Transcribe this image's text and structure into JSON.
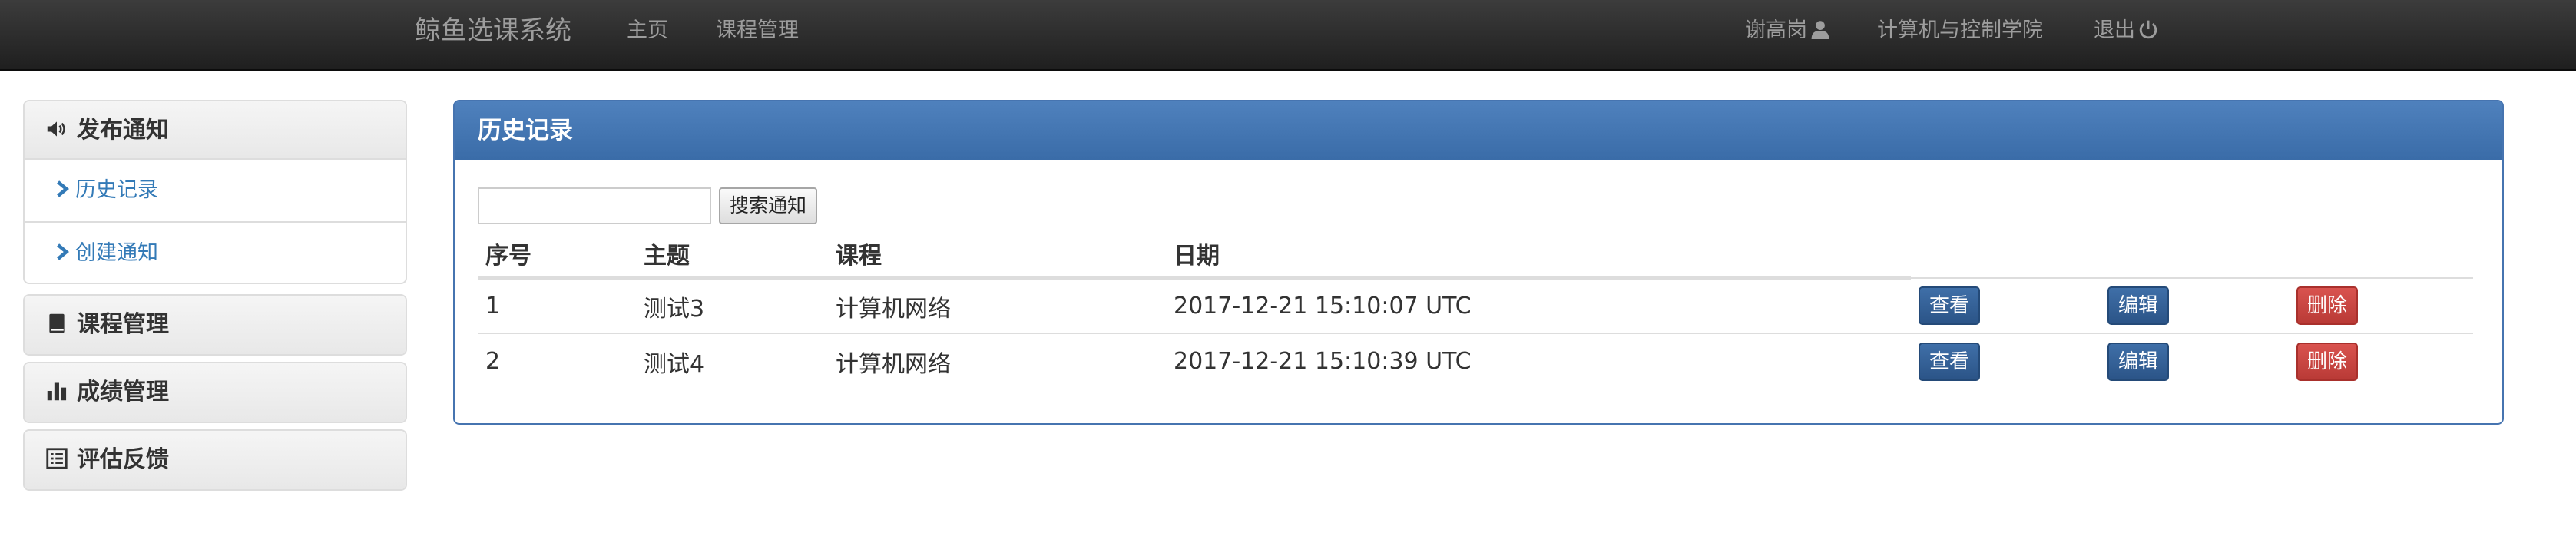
{
  "navbar": {
    "brand": "鲸鱼选课系统",
    "links": [
      "主页",
      "课程管理"
    ],
    "user": "谢高岗",
    "department": "计算机与控制学院",
    "logout": "退出"
  },
  "sidebar": {
    "sections": [
      {
        "label": "发布通知",
        "icon": "volume-icon",
        "items": [
          "历史记录",
          "创建通知"
        ]
      },
      {
        "label": "课程管理",
        "icon": "book-icon"
      },
      {
        "label": "成绩管理",
        "icon": "bar-chart-icon"
      },
      {
        "label": "评估反馈",
        "icon": "list-alt-icon"
      }
    ]
  },
  "main": {
    "title": "历史记录",
    "search": {
      "placeholder": "",
      "value": "",
      "button": "搜索通知"
    },
    "table": {
      "columns": [
        "序号",
        "主题",
        "课程",
        "日期"
      ],
      "rows": [
        {
          "id": "1",
          "subject": "测试3",
          "course": "计算机网络",
          "date": "2017-12-21 15:10:07 UTC"
        },
        {
          "id": "2",
          "subject": "测试4",
          "course": "计算机网络",
          "date": "2017-12-21 15:10:39 UTC"
        }
      ],
      "actions": {
        "view": "查看",
        "edit": "编辑",
        "delete": "删除"
      }
    }
  },
  "colors": {
    "navbar": "#222222",
    "panel_header": "#4674b0",
    "link": "#337ab7",
    "primary_button": "#2e5c95",
    "danger_button": "#c9302c"
  }
}
